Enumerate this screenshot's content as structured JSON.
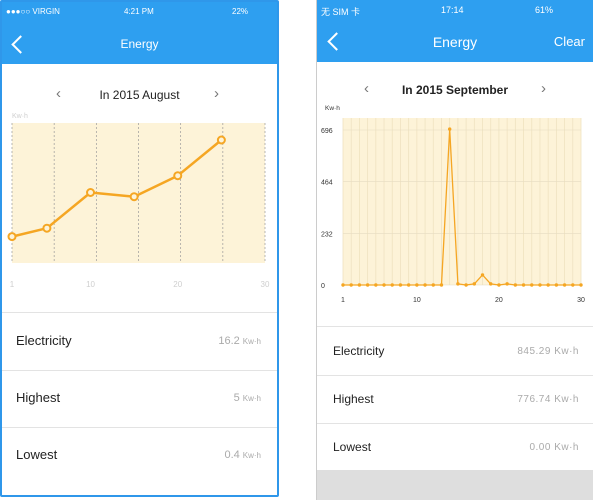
{
  "left": {
    "status": {
      "carrier": "VIRGIN",
      "time": "4:21 PM",
      "battery": "22%"
    },
    "title": "Energy",
    "month": "In 2015 August",
    "y_unit": "Kw·h",
    "stats": [
      {
        "label": "Electricity",
        "value": "16.2",
        "unit": "Kw·h"
      },
      {
        "label": "Highest",
        "value": "5",
        "unit": "Kw·h"
      },
      {
        "label": "Lowest",
        "value": "0.4",
        "unit": "Kw·h"
      }
    ]
  },
  "right": {
    "status": {
      "carrier": "无 SIM 卡",
      "time": "17:14",
      "battery": "61%"
    },
    "title": "Energy",
    "clear": "Clear",
    "month": "In 2015 September",
    "y_unit": "Kw·h",
    "stats": [
      {
        "label": "Electricity",
        "value": "845.29 Kw·h"
      },
      {
        "label": "Highest",
        "value": "776.74 Kw·h"
      },
      {
        "label": "Lowest",
        "value": "0.00 Kw·h"
      }
    ]
  },
  "colors": {
    "accent": "#2e9ff0",
    "line": "#f5a623",
    "plot_bg": "#fdf3d8"
  },
  "chart_data": [
    {
      "type": "line",
      "x": [
        1,
        5,
        10,
        15,
        20,
        25
      ],
      "values": [
        0.4,
        0.8,
        2.5,
        2.3,
        3.3,
        5.0
      ],
      "xticks": [
        "1",
        "10",
        "20",
        "30"
      ],
      "xlim": [
        1,
        30
      ],
      "ylim": [
        0,
        6
      ],
      "ylabel": "Kw·h"
    },
    {
      "type": "line",
      "x": [
        1,
        2,
        3,
        4,
        5,
        6,
        7,
        8,
        9,
        10,
        11,
        12,
        13,
        14,
        15,
        16,
        17,
        18,
        19,
        20,
        21,
        22,
        23,
        24,
        25,
        26,
        27,
        28,
        29,
        30
      ],
      "values": [
        0,
        0,
        0,
        0,
        0,
        0,
        0,
        0,
        0,
        0,
        0,
        0,
        0,
        700,
        5,
        0,
        5,
        45,
        5,
        0,
        5,
        0,
        0,
        0,
        0,
        0,
        0,
        0,
        0,
        0
      ],
      "xticks": [
        "1",
        "10",
        "20",
        "30"
      ],
      "yticks": [
        "0",
        "232",
        "464",
        "696"
      ],
      "xlim": [
        1,
        30
      ],
      "ylim": [
        0,
        696
      ],
      "ylabel": "Kw·h"
    }
  ]
}
